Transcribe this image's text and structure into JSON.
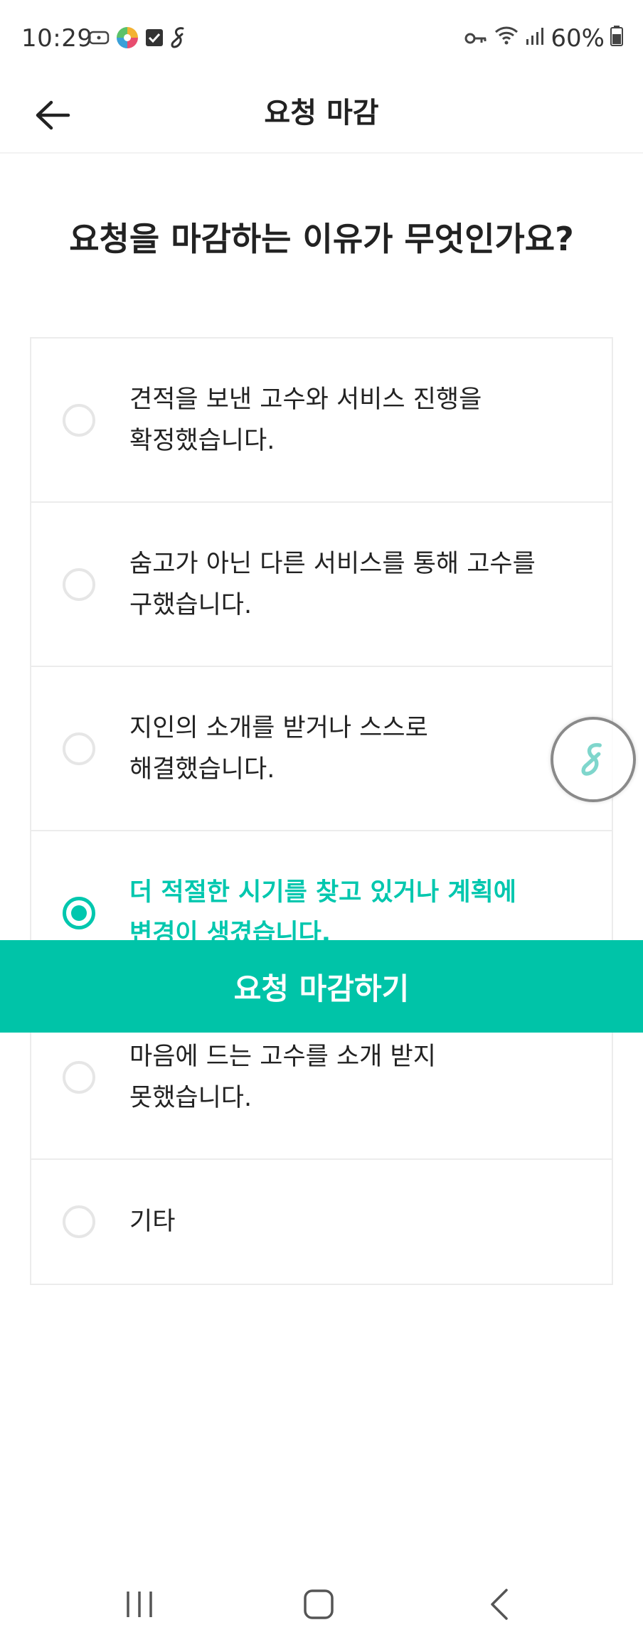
{
  "status_bar": {
    "time": "10:29",
    "battery": "60%",
    "left_icons": [
      "screen-record-icon",
      "app-pinwheel-icon",
      "checkbox-icon",
      "soomgo-s-icon"
    ],
    "right_icons": [
      "key-icon",
      "wifi-icon",
      "signal-icon",
      "battery-icon"
    ]
  },
  "app_bar": {
    "title": "요청 마감",
    "back_icon": "back-arrow-icon"
  },
  "question": "요청을 마감하는 이유가 무엇인가요?",
  "options": [
    {
      "label": "견적을 보낸 고수와 서비스 진행을\n확정했습니다.",
      "selected": false
    },
    {
      "label": "숨고가 아닌 다른 서비스를 통해 고수를\n구했습니다.",
      "selected": false
    },
    {
      "label": "지인의 소개를 받거나 스스로\n해결했습니다.",
      "selected": false
    },
    {
      "label": "더 적절한 시기를 찾고 있거나 계획에\n변경이 생겼습니다.",
      "selected": true
    },
    {
      "label": "마음에 드는 고수를 소개 받지\n못했습니다.",
      "selected": false
    },
    {
      "label": "기타",
      "selected": false
    }
  ],
  "primary_button": "요청 마감하기",
  "floating_button_icon": "soomgo-s-icon",
  "colors": {
    "accent": "#00c4a8",
    "selected_text": "#00c7ae",
    "border": "#ececec"
  },
  "nav_icons": [
    "recent-apps-icon",
    "home-icon",
    "back-icon"
  ]
}
